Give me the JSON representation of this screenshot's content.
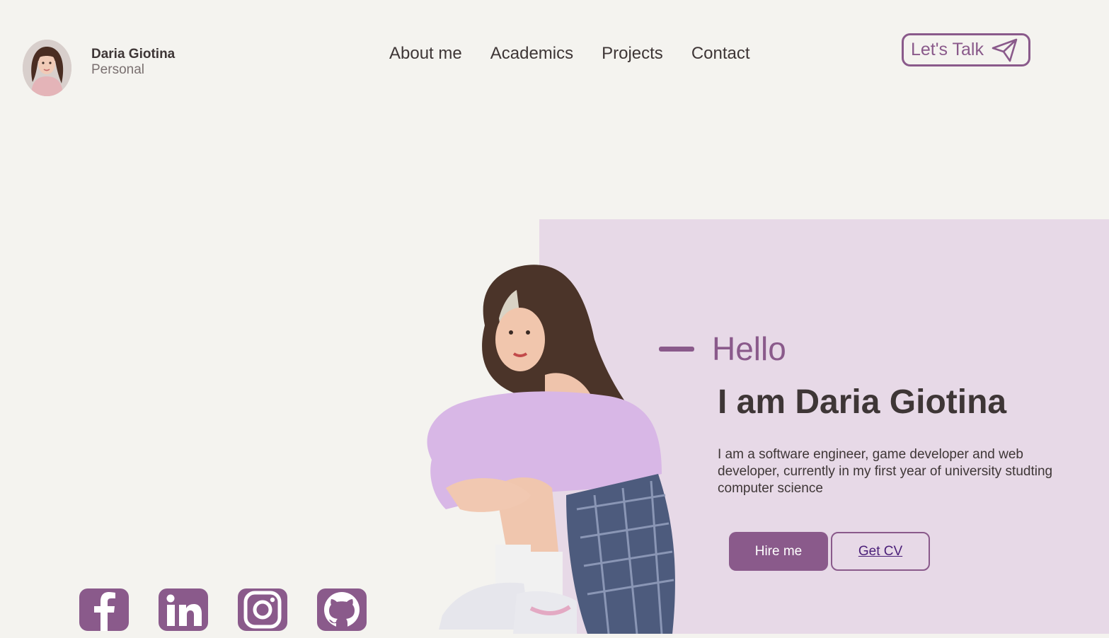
{
  "brand": {
    "name": "Daria Giotina",
    "subtitle": "Personal"
  },
  "nav": {
    "items": [
      {
        "label": "About me"
      },
      {
        "label": "Academics"
      },
      {
        "label": "Projects"
      },
      {
        "label": "Contact"
      }
    ]
  },
  "header": {
    "cta_label": "Let's Talk",
    "cta_icon": "paper-plane-icon"
  },
  "hero": {
    "greeting": "Hello",
    "headline": "I am Daria Giotina",
    "description": "I am a software engineer, game developer and web developer, currently in my first year of university studting computer science",
    "primary_button": "Hire me",
    "secondary_button": "Get CV"
  },
  "social": {
    "icons": [
      "facebook-icon",
      "linkedin-icon",
      "instagram-icon",
      "github-icon"
    ]
  },
  "colors": {
    "background": "#f4f3ef",
    "accent": "#8a5a8b",
    "panel": "#e7d9e7",
    "text": "#3e3636"
  }
}
